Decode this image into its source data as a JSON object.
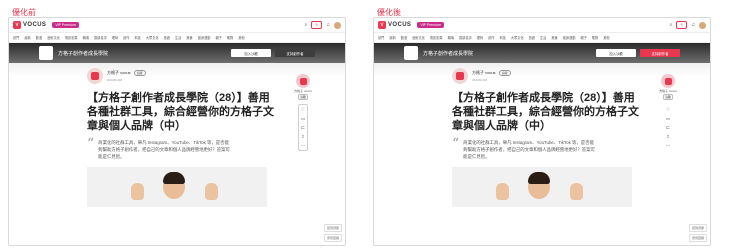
{
  "labels": {
    "before": "優化前",
    "after": "優化後"
  },
  "colors": {
    "accent": "#e8384f",
    "promo": "#c92c89",
    "before_btn": "#3d3d3d",
    "after_btn": "#e8384f"
  },
  "site": {
    "logo_text": "VOCUS",
    "promo": "VIP Premium",
    "nav": [
      "熱門",
      "最新",
      "動漫",
      "藝術文化",
      "電影影集",
      "職場",
      "閱讀書評",
      "理財",
      "創作",
      "科技",
      "大眾文化",
      "旅遊",
      "生活",
      "美食",
      "健身運動",
      "親子",
      "寵物",
      "其他"
    ]
  },
  "salon": {
    "name": "方格子創作者成長學院",
    "follow_button": "加入沙龍",
    "support_button": "支持創作者"
  },
  "article": {
    "author": "方格子 vocus",
    "follow": "追蹤",
    "date": "2023/01/18",
    "title": "【方格子創作者成長學院（28）】善用各種社群工具，綜合經營你的方格子文章與個人品牌（中）",
    "quote": "商業化的社群工具，舉凡 Instagram、YouTube、TikTok 等，是否能夠幫助方格子創作者，把自己的文章和個人品牌經營地更好？答案可能是仁見智。"
  },
  "rail": {
    "name": "方格子 vocus",
    "follow": "追蹤",
    "icons": [
      "heart-icon",
      "comment-icon",
      "bookmark-icon",
      "share-icon",
      "more-icon"
    ]
  },
  "corner": [
    "回到頂部",
    "意見回饋"
  ]
}
